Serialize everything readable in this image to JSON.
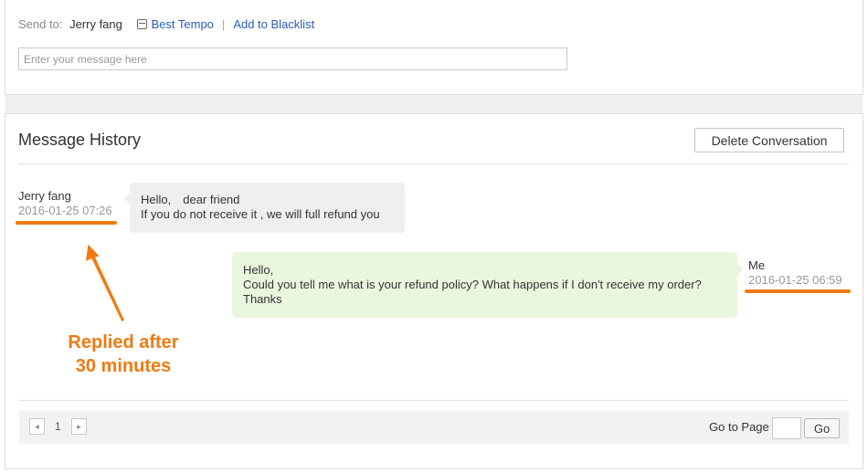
{
  "compose": {
    "send_to_label": "Send to:",
    "recipient": "Jerry fang",
    "store_icon": "store-icon",
    "store_link": "Best Tempo",
    "separator": "|",
    "blacklist_link": "Add to Blacklist",
    "message_placeholder": "Enter your message here"
  },
  "history": {
    "title": "Message History",
    "delete_label": "Delete Conversation",
    "messages": [
      {
        "sender": "Jerry fang",
        "timestamp": "2016-01-25 07:26",
        "lines": [
          "Hello,　dear friend",
          "If you do not receive it , we will full refund you"
        ]
      },
      {
        "sender": "Me",
        "timestamp": "2016-01-25 06:59",
        "lines": [
          "Hello,",
          "Could you tell me what is your refund policy? What happens if I don't receive my order?",
          "Thanks"
        ]
      }
    ]
  },
  "annotation": {
    "lines": [
      "Replied after",
      "30 minutes"
    ],
    "color": "#f07a10"
  },
  "pagination": {
    "prev_icon": "chevron-left-icon",
    "next_icon": "chevron-right-icon",
    "prev_glyph": "◂",
    "next_glyph": "▸",
    "current_page": "1",
    "goto_label": "Go to Page",
    "go_label": "Go"
  }
}
